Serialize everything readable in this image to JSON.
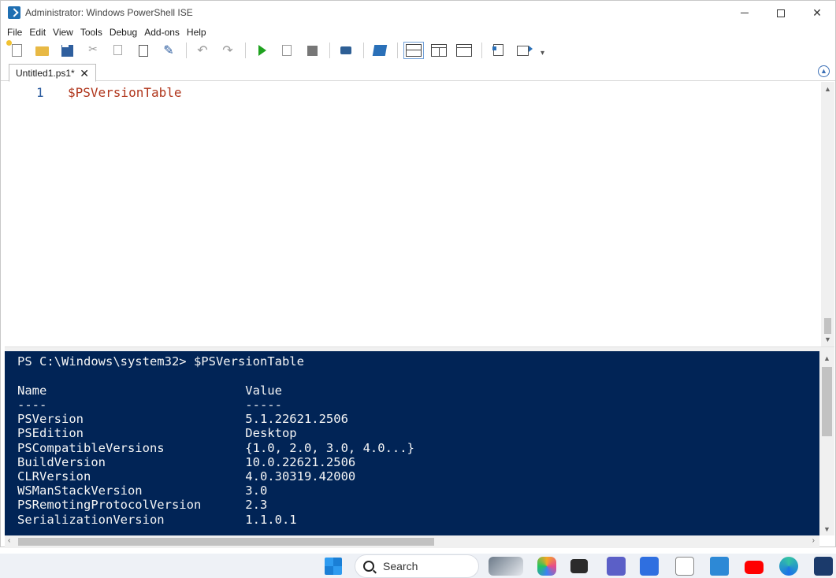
{
  "window": {
    "title": "Administrator: Windows PowerShell ISE"
  },
  "menu": {
    "items": [
      "File",
      "Edit",
      "View",
      "Tools",
      "Debug",
      "Add-ons",
      "Help"
    ]
  },
  "tabs": [
    {
      "label": "Untitled1.ps1*",
      "close_glyph": "✕"
    }
  ],
  "editor": {
    "lines": [
      {
        "number": "1",
        "text": "$PSVersionTable"
      }
    ]
  },
  "console": {
    "lines": [
      "PS C:\\Windows\\system32> $PSVersionTable",
      "",
      "Name                           Value",
      "----                           -----",
      "PSVersion                      5.1.22621.2506",
      "PSEdition                      Desktop",
      "PSCompatibleVersions           {1.0, 2.0, 3.0, 4.0...}",
      "BuildVersion                   10.0.22621.2506",
      "CLRVersion                     4.0.30319.42000",
      "WSManStackVersion              3.0",
      "PSRemotingProtocolVersion      2.3",
      "SerializationVersion           1.1.0.1"
    ]
  },
  "taskbar": {
    "search_label": "Search"
  }
}
